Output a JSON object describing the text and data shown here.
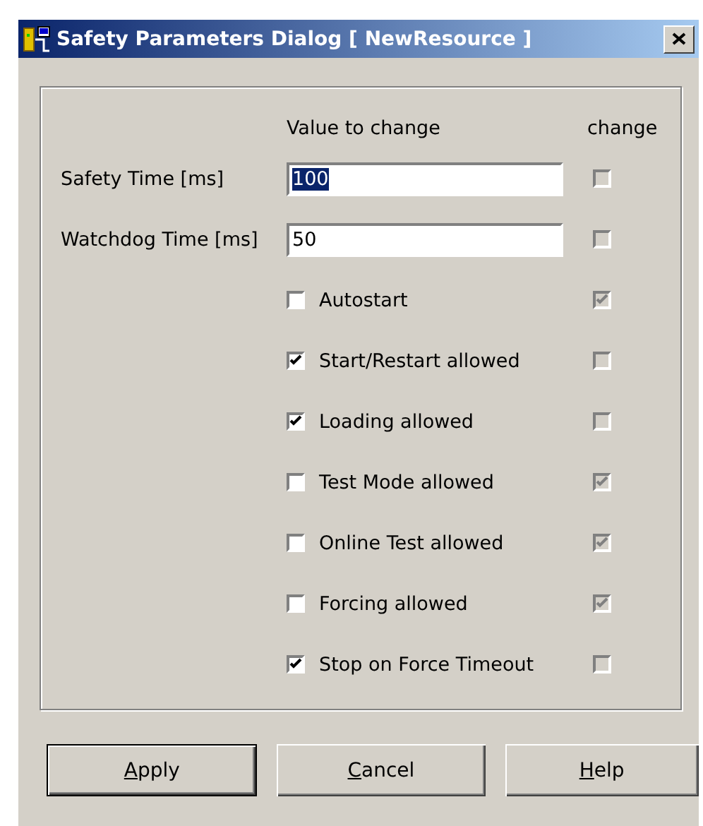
{
  "window": {
    "title": "Safety Parameters Dialog [ NewResource ]"
  },
  "headers": {
    "value": "Value to change",
    "change": "change"
  },
  "fields": [
    {
      "label": "Safety Time [ms]",
      "value": "100",
      "selected_text": true,
      "change": {
        "checked": false,
        "disabled": true
      }
    },
    {
      "label": "Watchdog Time [ms]",
      "value": "50",
      "selected_text": false,
      "change": {
        "checked": false,
        "disabled": true
      }
    }
  ],
  "options": [
    {
      "label": "Autostart",
      "checked": false,
      "change": {
        "checked": true,
        "disabled": true
      }
    },
    {
      "label": "Start/Restart allowed",
      "checked": true,
      "change": {
        "checked": false,
        "disabled": true
      }
    },
    {
      "label": "Loading allowed",
      "checked": true,
      "change": {
        "checked": false,
        "disabled": true
      }
    },
    {
      "label": "Test Mode allowed",
      "checked": false,
      "change": {
        "checked": true,
        "disabled": true
      }
    },
    {
      "label": "Online Test allowed",
      "checked": false,
      "change": {
        "checked": true,
        "disabled": true
      }
    },
    {
      "label": "Forcing allowed",
      "checked": false,
      "change": {
        "checked": true,
        "disabled": true
      }
    },
    {
      "label": "Stop on Force Timeout",
      "checked": true,
      "change": {
        "checked": false,
        "disabled": true
      }
    }
  ],
  "buttons": [
    {
      "access_key": "A",
      "rest": "pply",
      "default": true
    },
    {
      "access_key": "C",
      "rest": "ancel",
      "default": false
    },
    {
      "access_key": "H",
      "rest": "elp",
      "default": false
    }
  ]
}
